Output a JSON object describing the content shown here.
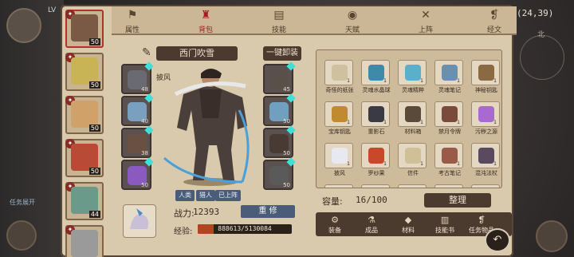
{
  "hud": {
    "coords": "(24,39)",
    "level_prefix": "LV",
    "compass_north": "北",
    "task_toggle": "任务展开"
  },
  "tabs": [
    {
      "label": "属性",
      "icon": "banner-icon",
      "active": false
    },
    {
      "label": "背包",
      "icon": "backpack-icon",
      "active": true
    },
    {
      "label": "技能",
      "icon": "book-icon",
      "active": false
    },
    {
      "label": "天赋",
      "icon": "eye-icon",
      "active": false
    },
    {
      "label": "上阵",
      "icon": "crossed-swords-icon",
      "active": false
    },
    {
      "label": "经文",
      "icon": "scroll-icon",
      "active": false
    }
  ],
  "roster": [
    {
      "level": "50",
      "color": "#7a5a44",
      "selected": true
    },
    {
      "level": "50",
      "color": "#c9b455",
      "selected": false
    },
    {
      "level": "50",
      "color": "#d0a26a",
      "selected": false
    },
    {
      "level": "50",
      "color": "#b84a36",
      "selected": false
    },
    {
      "level": "44",
      "color": "#6a9a8a",
      "selected": false
    },
    {
      "level": "",
      "color": "#9a9a9a",
      "selected": false
    }
  ],
  "character": {
    "name": "西门吹雪",
    "tag": "披风",
    "unequip_all": "一键卸装",
    "traits": [
      "人类",
      "猎人",
      "已上阵"
    ],
    "power_label": "战力:",
    "power_value": "12393",
    "reform_button": "重 修",
    "exp_label": "经验:",
    "exp_text": "888613/5130084",
    "exp_fraction": 0.173
  },
  "equipment": [
    {
      "slot": "head-left",
      "count": "48",
      "color": "#6a6a72"
    },
    {
      "slot": "shoulder-left",
      "count": "40",
      "color": "#7aa0c0"
    },
    {
      "slot": "body-left",
      "count": "38",
      "color": "#6a5040"
    },
    {
      "slot": "belt-left",
      "count": "50",
      "color": "#8a5ac0"
    },
    {
      "slot": "head-right",
      "count": "45",
      "color": "#5a504a"
    },
    {
      "slot": "weapon-right",
      "count": "50",
      "color": "#70a0c0"
    },
    {
      "slot": "armor-right",
      "count": "50",
      "color": "#4a3a34"
    },
    {
      "slot": "accessory-right",
      "count": "50",
      "color": "#5a5a5a"
    }
  ],
  "inventory": {
    "capacity_label": "容量:",
    "capacity_value": "16/100",
    "sort_button": "整理",
    "items": [
      {
        "name": "奇怪的纸张",
        "count": "1",
        "color": "#cfc0a0"
      },
      {
        "name": "灵魂水晶球",
        "count": "1",
        "color": "#3e8aa8"
      },
      {
        "name": "灵魂精粹",
        "count": "1",
        "color": "#5ab0c8"
      },
      {
        "name": "灵魂笔记",
        "count": "1",
        "color": "#6a90b0"
      },
      {
        "name": "神秘钥匙",
        "count": "1",
        "color": "#8a6a40"
      },
      {
        "name": "宝库钥匙",
        "count": "1",
        "color": "#c08a30"
      },
      {
        "name": "重影石",
        "count": "1",
        "color": "#3a3a44"
      },
      {
        "name": "材料箱",
        "count": "1",
        "color": "#5a4a3a"
      },
      {
        "name": "禁月令牌",
        "count": "1",
        "color": "#7a4a3a"
      },
      {
        "name": "污秽之源",
        "count": "1",
        "color": "#a86ad0"
      },
      {
        "name": "披风",
        "count": "1",
        "color": "#e8e8f0"
      },
      {
        "name": "罗纱果",
        "count": "1",
        "color": "#c8482a"
      },
      {
        "name": "信件",
        "count": "1",
        "color": "#d0c098"
      },
      {
        "name": "考古笔记",
        "count": "1",
        "color": "#9a5a48"
      },
      {
        "name": "混沌法杖",
        "count": "1",
        "color": "#5a4a60"
      }
    ]
  },
  "inventory_tabs": [
    {
      "label": "装备",
      "icon": "gear-icon"
    },
    {
      "label": "成品",
      "icon": "potion-icon"
    },
    {
      "label": "材料",
      "icon": "ore-icon"
    },
    {
      "label": "技能书",
      "icon": "skillbook-icon"
    },
    {
      "label": "任务物品",
      "icon": "quest-scroll-icon"
    }
  ]
}
